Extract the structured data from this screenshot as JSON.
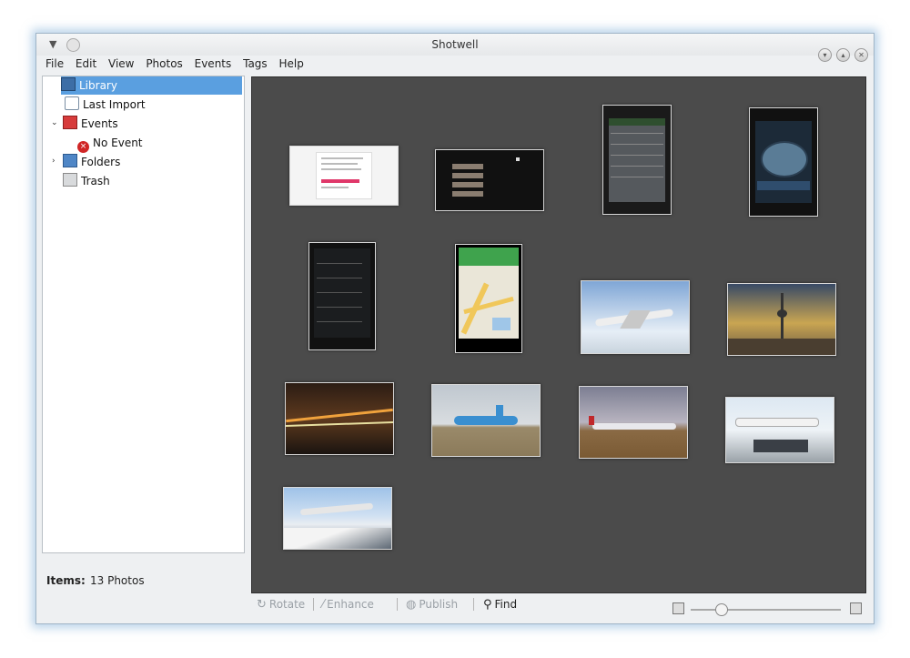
{
  "window": {
    "title": "Shotwell"
  },
  "menu": [
    "File",
    "Edit",
    "View",
    "Photos",
    "Events",
    "Tags",
    "Help"
  ],
  "sidebar": {
    "items": [
      {
        "label": "Library",
        "icon": "library-icon",
        "selected": true
      },
      {
        "label": "Last Import",
        "icon": "import-icon"
      },
      {
        "label": "Events",
        "icon": "events-icon",
        "expanded": true
      },
      {
        "label": "No Event",
        "icon": "no-event-icon"
      },
      {
        "label": "Folders",
        "icon": "folder-icon",
        "expanded": false
      },
      {
        "label": "Trash",
        "icon": "trash-icon"
      }
    ]
  },
  "status": {
    "label": "Items:",
    "value": "13 Photos"
  },
  "toolbar": {
    "rotate": "Rotate",
    "enhance": "Enhance",
    "publish": "Publish",
    "find": "Find"
  },
  "colors": {
    "grid_bg": "#4b4b4b",
    "selection": "#5a9fe0"
  },
  "photos": [
    {
      "name": "web-page-screenshot"
    },
    {
      "name": "dark-menu-screenshot"
    },
    {
      "name": "phone-settings-screenshot"
    },
    {
      "name": "phone-speedometer-screenshot"
    },
    {
      "name": "phone-list-screenshot"
    },
    {
      "name": "phone-map-screenshot"
    },
    {
      "name": "airplane-in-flight"
    },
    {
      "name": "city-tower-skyline"
    },
    {
      "name": "airplane-night-runway"
    },
    {
      "name": "klm-airplane-taxiing"
    },
    {
      "name": "airplane-on-tarmac"
    },
    {
      "name": "airplane-with-crowd"
    },
    {
      "name": "airplane-over-mountains"
    }
  ]
}
